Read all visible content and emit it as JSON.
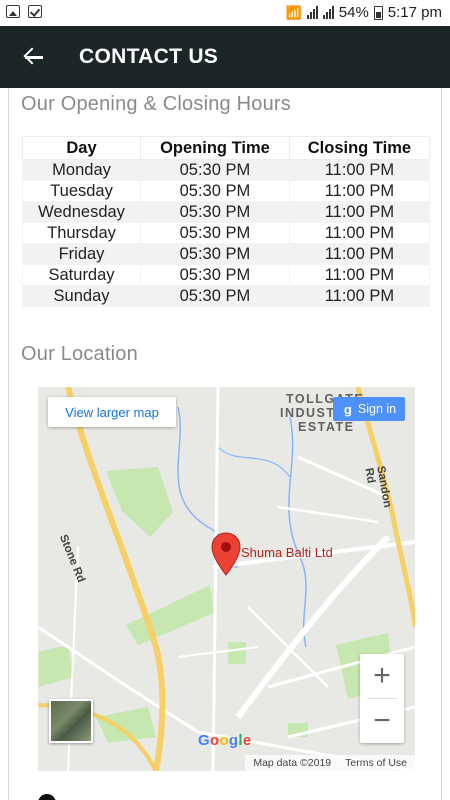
{
  "status_bar": {
    "battery": "54%",
    "time": "5:17 pm"
  },
  "toolbar": {
    "title": "CONTACT US"
  },
  "hours_section": {
    "title": "Our Opening & Closing Hours",
    "headers": [
      "Day",
      "Opening Time",
      "Closing Time"
    ],
    "rows": [
      [
        "Monday",
        "05:30 PM",
        "11:00 PM"
      ],
      [
        "Tuesday",
        "05:30 PM",
        "11:00 PM"
      ],
      [
        "Wednesday",
        "05:30 PM",
        "11:00 PM"
      ],
      [
        "Thursday",
        "05:30 PM",
        "11:00 PM"
      ],
      [
        "Friday",
        "05:30 PM",
        "11:00 PM"
      ],
      [
        "Saturday",
        "05:30 PM",
        "11:00 PM"
      ],
      [
        "Sunday",
        "05:30 PM",
        "11:00 PM"
      ]
    ]
  },
  "location_section": {
    "title": "Our Location"
  },
  "map": {
    "view_larger": "View larger map",
    "sign_in": "Sign in",
    "sign_in_icon": "g",
    "area_label_1": "TOLLGATE",
    "area_label_2": "INDUSTRIAL",
    "area_label_3": "ESTATE",
    "road_stone": "Stone Rd",
    "road_sandon": "Sandon Rd",
    "place_name": "Shuma Balti Ltd",
    "zoom_in": "+",
    "zoom_out": "−",
    "google_logo": [
      "G",
      "o",
      "o",
      "g",
      "l",
      "e"
    ],
    "google_colors": [
      "#4285f4",
      "#ea4335",
      "#fbbc05",
      "#4285f4",
      "#34a853",
      "#ea4335"
    ],
    "map_data": "Map data ©2019",
    "terms": "Terms of Use"
  },
  "colors": {
    "toolbar": "#1c2628",
    "pin": "#ea4335",
    "road_major": "#f6cf65",
    "park": "#c6e8b0",
    "water": "#8ab4f8"
  }
}
